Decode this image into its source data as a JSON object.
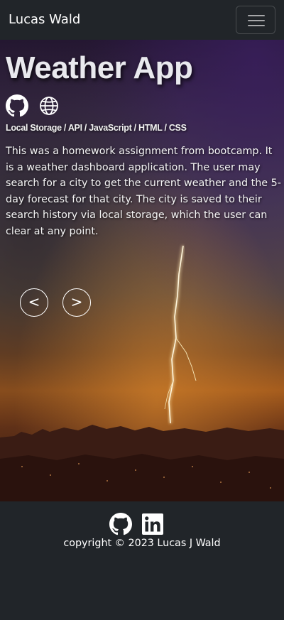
{
  "navbar": {
    "brand": "Lucas Wald",
    "toggle_icon": "hamburger-menu-icon"
  },
  "project": {
    "title": "Weather App",
    "links": [
      {
        "icon": "github-icon"
      },
      {
        "icon": "globe-icon"
      }
    ],
    "technologies": "Local Storage / API / JavaScript / HTML / CSS",
    "description": "This was a homework assignment from bootcamp. It is a weather dashboard application. The user may search for a city to get the current weather and the 5-day forecast for that city. The city is saved to their search history via local storage, which the user can clear at any point.",
    "prev_label": "<",
    "next_label": ">"
  },
  "footer": {
    "links": [
      {
        "icon": "github-icon"
      },
      {
        "icon": "linkedin-icon"
      }
    ],
    "copyright": "copyright © 2023 Lucas J Wald"
  },
  "colors": {
    "navbar_bg": "#212529",
    "text": "#ffffff"
  }
}
